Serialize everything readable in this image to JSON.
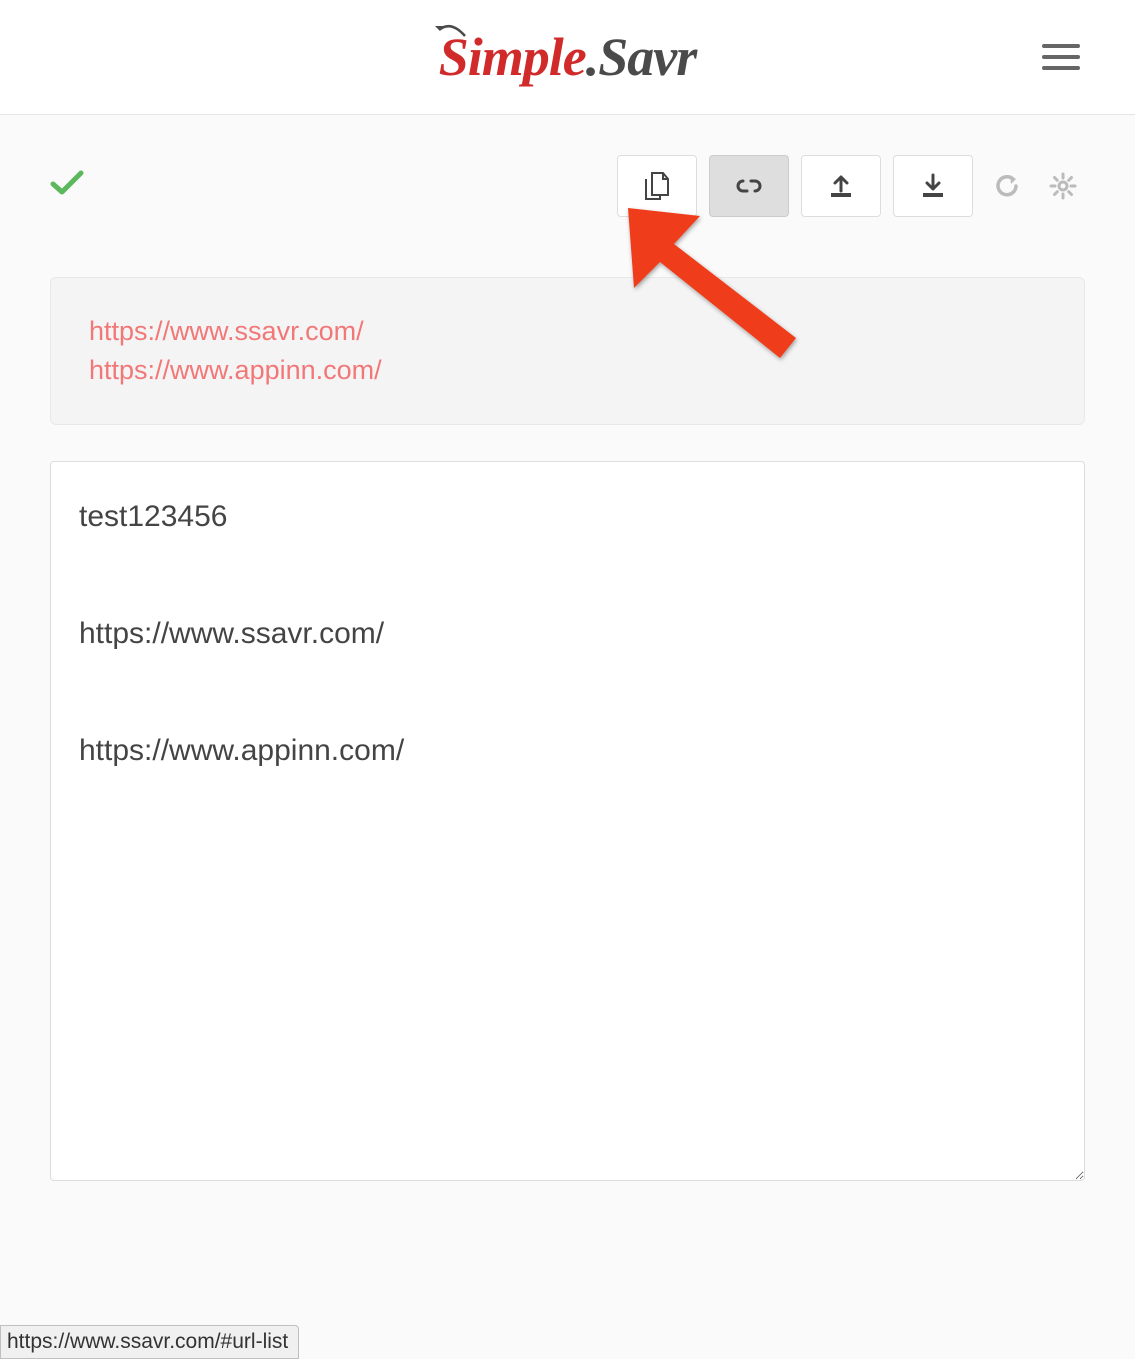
{
  "brand": {
    "part1": "Simple",
    "dot": ".",
    "part2": "Savr"
  },
  "toolbar": {
    "copy_name": "copy-button",
    "link_name": "link-button",
    "upload_name": "upload-button",
    "download_name": "download-button",
    "refresh_name": "refresh-button",
    "settings_name": "settings-button"
  },
  "url_list": {
    "items": [
      "https://www.ssavr.com/",
      "https://www.appinn.com/"
    ]
  },
  "note_content": "test123456\n\nhttps://www.ssavr.com/\n\nhttps://www.appinn.com/",
  "status_url": "https://www.ssavr.com/#url-list"
}
